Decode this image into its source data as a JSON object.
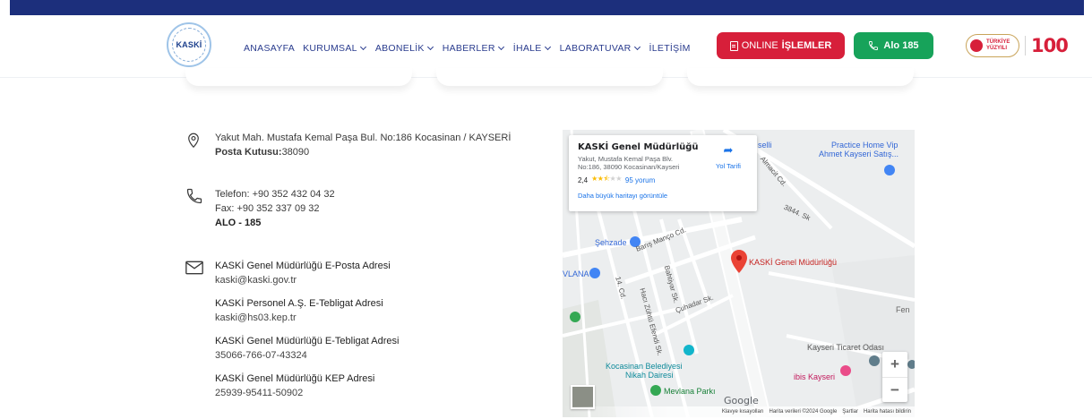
{
  "header": {
    "logo_text": "KASKİ",
    "nav": [
      {
        "label": "ANASAYFA",
        "dropdown": false
      },
      {
        "label": "KURUMSAL",
        "dropdown": true
      },
      {
        "label": "ABONELİK",
        "dropdown": true
      },
      {
        "label": "HABERLER",
        "dropdown": true
      },
      {
        "label": "İHALE",
        "dropdown": true
      },
      {
        "label": "LABORATUVAR",
        "dropdown": true
      },
      {
        "label": "İLETİŞİM",
        "dropdown": false
      }
    ],
    "online_button": {
      "prefix": "ONLINE ",
      "bold": "İŞLEMLER"
    },
    "alo_button": "Alo 185",
    "brand": {
      "badge_line1": "TÜRKİYE",
      "badge_line2": "YÜZYILI",
      "hundred": "100"
    }
  },
  "contact": {
    "address": {
      "line": "Yakut Mah. Mustafa Kemal Paşa Bul. No:186 Kocasinan / KAYSERİ",
      "po_label": "Posta Kutusu:",
      "po_value": "38090"
    },
    "phone": {
      "tel": "Telefon: +90 352 432 04 32",
      "fax": "Fax: +90 352 337 09 32",
      "alo": "ALO - 185"
    },
    "emails": [
      {
        "title": "KASKİ Genel Müdürlüğü E-Posta Adresi",
        "value": "kaski@kaski.gov.tr"
      },
      {
        "title": "KASKİ Personel A.Ş. E-Tebligat Adresi",
        "value": "kaski@hs03.kep.tr"
      },
      {
        "title": "KASKİ Genel Müdürlüğü E-Tebligat Adresi",
        "value": "35066-766-07-43324"
      },
      {
        "title": "KASKİ Genel Müdürlüğü KEP Adresi",
        "value": "25939-95411-50902"
      }
    ]
  },
  "map": {
    "card": {
      "title": "KASKİ Genel Müdürlüğü",
      "address": "Yakut, Mustafa Kemal Paşa Blv. No:186, 38090 Kocasinan/Kayseri",
      "rating": "2,4",
      "stars_filled": 2.5,
      "reviews": "95 yorum",
      "bigger_map": "Daha büyük haritayı görüntüle",
      "directions": "Yol Tarifi"
    },
    "labels": {
      "pin": "KASKİ Genel Müdürlüğü",
      "practice": "Practice Home Vip",
      "practice2": "Ahmet Kayseri Satış...",
      "sehzade": "Şehzade",
      "mevlana": "VLANA",
      "belediye1": "Kocasinan Belediyesi",
      "belediye2": "Nikah Dairesi",
      "mevlana_park": "Mevlana Parkı",
      "ticaret": "Kayseri Ticaret Odası",
      "ibis": "ibis Kayseri",
      "fen": "Fen",
      "baris": "Barış Manço Cd.",
      "cuhadar": "Çuhadar Sk.",
      "s3844": "3844. Sk",
      "almaci": "Almacit Cd.",
      "baki": "Bahtiyar Sk.",
      "selli": "selli",
      "hacizuhtu": "Hacı Zühtü Efendi Sk.",
      "s14": "14. Cd.",
      "google": "Google"
    },
    "footer": [
      "Klavye kısayolları",
      "Harita verileri ©2024 Google",
      "Şartlar",
      "Harita hatası bildirin"
    ],
    "zoom_in": "+",
    "zoom_out": "−"
  },
  "colors": {
    "topbar": "#1c2f7c",
    "online": "#d71f3a",
    "alo": "#17a35a",
    "nav": "#2a3c8e"
  }
}
